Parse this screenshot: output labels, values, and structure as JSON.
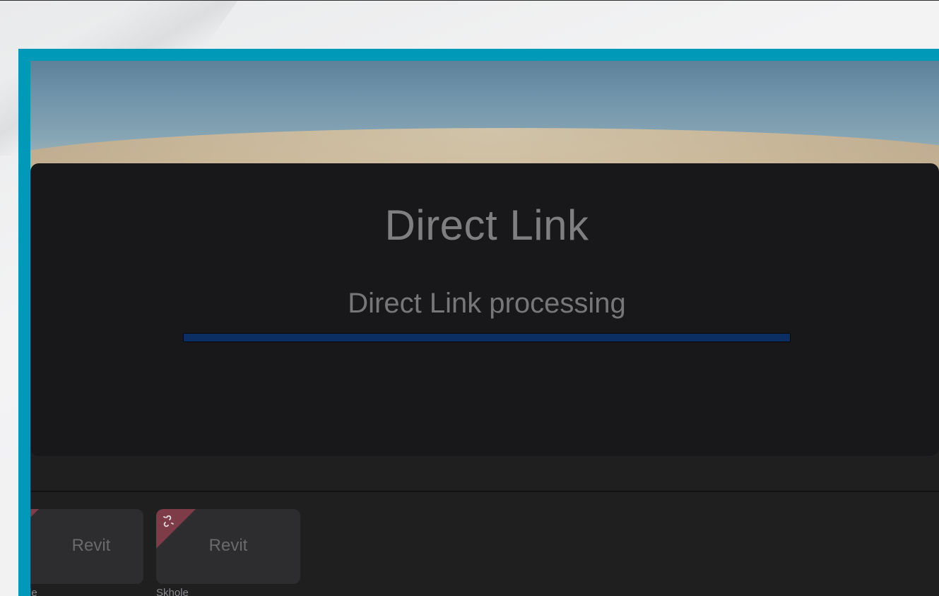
{
  "modal": {
    "title": "Direct Link",
    "status": "Direct Link processing",
    "progress": 1.0
  },
  "tiles": [
    {
      "label": "Revit",
      "caption": "le",
      "icon": "unlink-icon"
    },
    {
      "label": "Revit",
      "caption": "Skhole",
      "icon": "unlink-icon"
    }
  ],
  "colors": {
    "frame_accent": "#009ab8",
    "modal_bg": "#18181b",
    "progress_fill": "#0b2f63",
    "tile_badge": "#7d3c47"
  }
}
